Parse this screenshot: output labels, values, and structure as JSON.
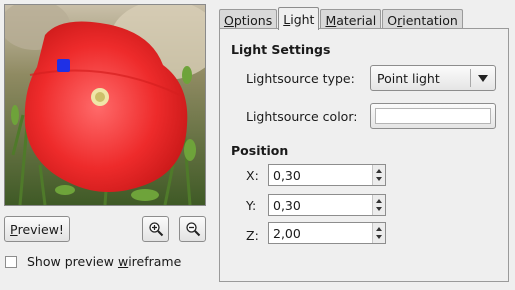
{
  "preview": {
    "image_description_icon": "poppy-flower-preview-image",
    "light_marker_color": "#1f30e6",
    "preview_button_pre": "",
    "preview_button_underline": "P",
    "preview_button_post": "review!",
    "zoom_in_icon": "zoom-in-icon",
    "zoom_out_icon": "zoom-out-icon",
    "wireframe_label_pre": "Show preview ",
    "wireframe_label_underline": "w",
    "wireframe_label_post": "ireframe",
    "wireframe_checked": false
  },
  "tabs": [
    {
      "label_underline": "O",
      "label_rest": "ptions",
      "active": false
    },
    {
      "label_underline": "L",
      "label_rest": "ight",
      "active": true
    },
    {
      "label_underline": "M",
      "label_rest": "aterial",
      "active": false
    },
    {
      "label_pre": "O",
      "label_underline": "r",
      "label_rest": "ientation",
      "active": false
    }
  ],
  "light_settings": {
    "title": "Light Settings",
    "type_label": "Lightsource type:",
    "type_value": "Point light",
    "color_label": "Lightsource color:",
    "color_value": "#ffffff"
  },
  "position": {
    "title": "Position",
    "x_label": "X:",
    "x_value": "0,30",
    "y_label": "Y:",
    "y_value": "0,30",
    "z_label": "Z:",
    "z_value": "2,00"
  }
}
